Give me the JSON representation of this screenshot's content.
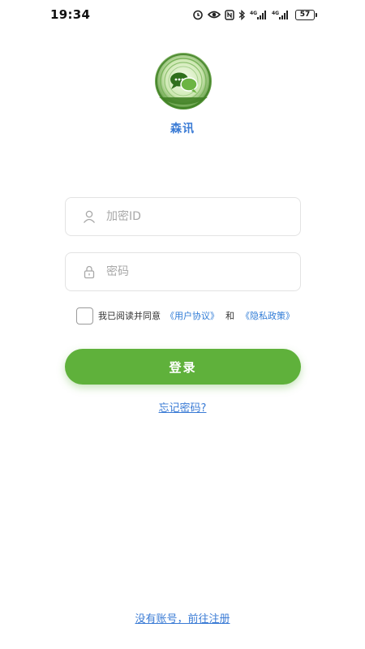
{
  "status_bar": {
    "time": "19:34",
    "network_1": "4G",
    "network_2": "4G",
    "battery": "57",
    "icons": [
      "alarm-icon",
      "eye-icon",
      "nfc-icon",
      "bluetooth-icon",
      "signal-icon",
      "signal-icon",
      "battery-icon"
    ]
  },
  "app": {
    "logo_icon": "chat-bubbles-wood-logo",
    "name": "森讯"
  },
  "form": {
    "id_placeholder": "加密ID",
    "id_value": "",
    "password_placeholder": "密码",
    "password_value": ""
  },
  "agreement": {
    "checked": false,
    "text": "我已阅读并同意",
    "user_agreement": "《用户协议》",
    "and": "和",
    "privacy_policy": "《隐私政策》"
  },
  "login_button": "登录",
  "forgot_password": "忘记密码?",
  "register_link": "没有账号，前往注册",
  "colors": {
    "accent_green": "#5fb13b",
    "link_blue": "#3a7bd5"
  }
}
